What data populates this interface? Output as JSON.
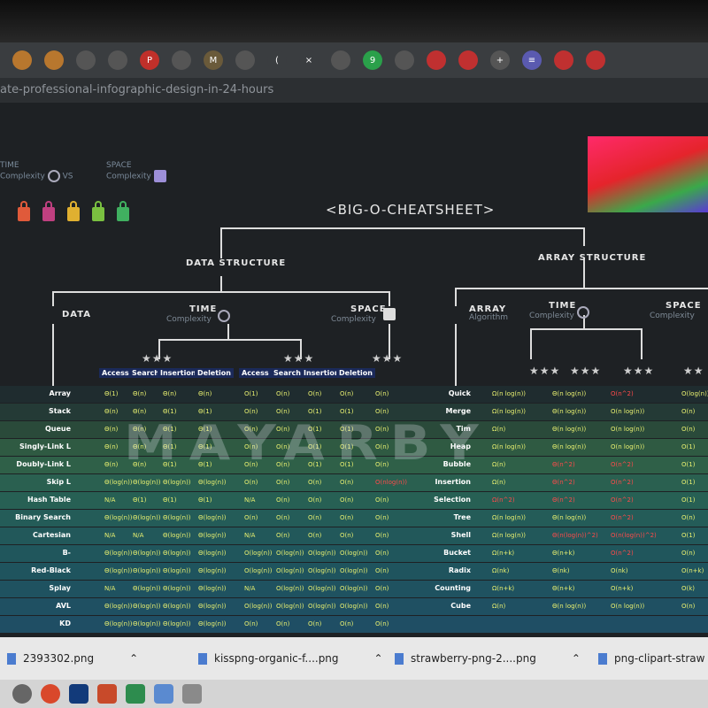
{
  "browser": {
    "url_fragment": "ate-professional-infographic-design-in-24-hours",
    "tab_glyphs": [
      "",
      "",
      "",
      "",
      "P",
      "",
      "M",
      "",
      "(",
      "×",
      "",
      "9",
      "",
      "",
      "",
      "+",
      "≡",
      "",
      ""
    ]
  },
  "legend": {
    "time": "TIME",
    "time_sub": "Complexity",
    "vs": "VS",
    "space": "SPACE",
    "space_sub": "Complexity"
  },
  "title": "<BIG-O-CHEATSHEET>",
  "sections": {
    "data_structure": {
      "label": "DATA STRUCTURE",
      "data": "DATA",
      "time": "TIME",
      "time_sub": "Complexity",
      "space": "SPACE",
      "space_sub": "Complexity"
    },
    "array_structure": {
      "label": "ARRAY STRUCTURE",
      "array": "ARRAY",
      "array_sub": "Algorithm",
      "time": "TIME",
      "time_sub": "Complexity",
      "space": "SPACE",
      "space_sub": "Complexity"
    }
  },
  "stars": [
    "★★★",
    "★★★",
    "★★★",
    "★★★",
    "★★★",
    "★★★",
    "★★"
  ],
  "column_headers": [
    "Access",
    "Search",
    "Insertion",
    "Deletion",
    "Access",
    "Search",
    "Insertion",
    "Deletion"
  ],
  "data_structures": [
    {
      "name": "Array",
      "cells": [
        "Θ(1)",
        "Θ(n)",
        "Θ(n)",
        "Θ(n)",
        "O(1)",
        "O(n)",
        "O(n)",
        "O(n)",
        "O(n)"
      ]
    },
    {
      "name": "Stack",
      "cells": [
        "Θ(n)",
        "Θ(n)",
        "Θ(1)",
        "Θ(1)",
        "O(n)",
        "O(n)",
        "O(1)",
        "O(1)",
        "O(n)"
      ]
    },
    {
      "name": "Queue",
      "cells": [
        "Θ(n)",
        "Θ(n)",
        "Θ(1)",
        "Θ(1)",
        "O(n)",
        "O(n)",
        "O(1)",
        "O(1)",
        "O(n)"
      ]
    },
    {
      "name": "Singly-Link L",
      "cells": [
        "Θ(n)",
        "Θ(n)",
        "Θ(1)",
        "Θ(1)",
        "O(n)",
        "O(n)",
        "O(1)",
        "O(1)",
        "O(n)"
      ]
    },
    {
      "name": "Doubly-Link L",
      "cells": [
        "Θ(n)",
        "Θ(n)",
        "Θ(1)",
        "Θ(1)",
        "O(n)",
        "O(n)",
        "O(1)",
        "O(1)",
        "O(n)"
      ]
    },
    {
      "name": "Skip L",
      "cells": [
        "Θ(log(n))",
        "Θ(log(n))",
        "Θ(log(n))",
        "Θ(log(n))",
        "O(n)",
        "O(n)",
        "O(n)",
        "O(n)",
        "O(nlog(n))"
      ]
    },
    {
      "name": "Hash Table",
      "cells": [
        "N/A",
        "Θ(1)",
        "Θ(1)",
        "Θ(1)",
        "N/A",
        "O(n)",
        "O(n)",
        "O(n)",
        "O(n)"
      ]
    },
    {
      "name": "Binary Search",
      "cells": [
        "Θ(log(n))",
        "Θ(log(n))",
        "Θ(log(n))",
        "Θ(log(n))",
        "O(n)",
        "O(n)",
        "O(n)",
        "O(n)",
        "O(n)"
      ]
    },
    {
      "name": "Cartesian",
      "cells": [
        "N/A",
        "N/A",
        "Θ(log(n))",
        "Θ(log(n))",
        "N/A",
        "O(n)",
        "O(n)",
        "O(n)",
        "O(n)"
      ]
    },
    {
      "name": "B-",
      "cells": [
        "Θ(log(n))",
        "Θ(log(n))",
        "Θ(log(n))",
        "Θ(log(n))",
        "O(log(n))",
        "O(log(n))",
        "O(log(n))",
        "O(log(n))",
        "O(n)"
      ]
    },
    {
      "name": "Red-Black",
      "cells": [
        "Θ(log(n))",
        "Θ(log(n))",
        "Θ(log(n))",
        "Θ(log(n))",
        "O(log(n))",
        "O(log(n))",
        "O(log(n))",
        "O(log(n))",
        "O(n)"
      ]
    },
    {
      "name": "Splay",
      "cells": [
        "N/A",
        "Θ(log(n))",
        "Θ(log(n))",
        "Θ(log(n))",
        "N/A",
        "O(log(n))",
        "O(log(n))",
        "O(log(n))",
        "O(n)"
      ]
    },
    {
      "name": "AVL",
      "cells": [
        "Θ(log(n))",
        "Θ(log(n))",
        "Θ(log(n))",
        "Θ(log(n))",
        "O(log(n))",
        "O(log(n))",
        "O(log(n))",
        "O(log(n))",
        "O(n)"
      ]
    },
    {
      "name": "KD",
      "cells": [
        "Θ(log(n))",
        "Θ(log(n))",
        "Θ(log(n))",
        "Θ(log(n))",
        "O(n)",
        "O(n)",
        "O(n)",
        "O(n)",
        "O(n)"
      ]
    }
  ],
  "algorithms": [
    {
      "name": "Quick",
      "cells": [
        "Ω(n log(n))",
        "Θ(n log(n))",
        "O(n^2)",
        "O(log(n))"
      ]
    },
    {
      "name": "Merge",
      "cells": [
        "Ω(n log(n))",
        "Θ(n log(n))",
        "O(n log(n))",
        "O(n)"
      ]
    },
    {
      "name": "Tim",
      "cells": [
        "Ω(n)",
        "Θ(n log(n))",
        "O(n log(n))",
        "O(n)"
      ]
    },
    {
      "name": "Heap",
      "cells": [
        "Ω(n log(n))",
        "Θ(n log(n))",
        "O(n log(n))",
        "O(1)"
      ]
    },
    {
      "name": "Bubble",
      "cells": [
        "Ω(n)",
        "Θ(n^2)",
        "O(n^2)",
        "O(1)"
      ]
    },
    {
      "name": "Insertion",
      "cells": [
        "Ω(n)",
        "Θ(n^2)",
        "O(n^2)",
        "O(1)"
      ]
    },
    {
      "name": "Selection",
      "cells": [
        "Ω(n^2)",
        "Θ(n^2)",
        "O(n^2)",
        "O(1)"
      ]
    },
    {
      "name": "Tree",
      "cells": [
        "Ω(n log(n))",
        "Θ(n log(n))",
        "O(n^2)",
        "O(n)"
      ]
    },
    {
      "name": "Shell",
      "cells": [
        "Ω(n log(n))",
        "Θ(n(log(n))^2)",
        "O(n(log(n))^2)",
        "O(1)"
      ]
    },
    {
      "name": "Bucket",
      "cells": [
        "Ω(n+k)",
        "Θ(n+k)",
        "O(n^2)",
        "O(n)"
      ]
    },
    {
      "name": "Radix",
      "cells": [
        "Ω(nk)",
        "Θ(nk)",
        "O(nk)",
        "O(n+k)"
      ]
    },
    {
      "name": "Counting",
      "cells": [
        "Ω(n+k)",
        "Θ(n+k)",
        "O(n+k)",
        "O(k)"
      ]
    },
    {
      "name": "Cube",
      "cells": [
        "Ω(n)",
        "Θ(n log(n))",
        "O(n log(n))",
        "O(n)"
      ]
    }
  ],
  "watermark": "MAYARBY",
  "downloads": [
    {
      "name": "2393302.png"
    },
    {
      "name": "kisspng-organic-f....png"
    },
    {
      "name": "strawberry-png-2....png"
    },
    {
      "name": "png-clipart-straw"
    }
  ],
  "colors": {
    "accent_cells": "#e8f070",
    "header_bg": "#1b2a5a",
    "red_cells": "#ff4a4a"
  }
}
